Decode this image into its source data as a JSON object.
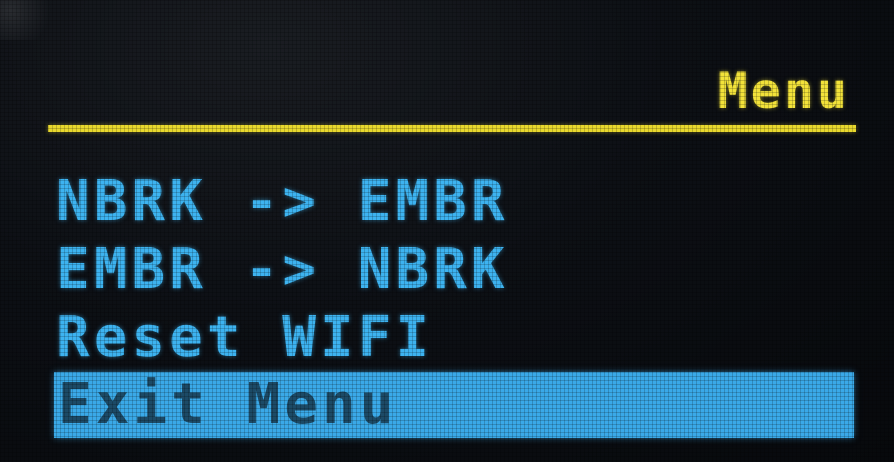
{
  "header": {
    "title": "Menu"
  },
  "menu": {
    "items": [
      {
        "label": "NBRK -> EMBR"
      },
      {
        "label": "EMBR -> NBRK"
      },
      {
        "label": "Reset WIFI"
      },
      {
        "label": "Exit Menu",
        "selected": true
      }
    ]
  },
  "colors": {
    "title": "#f2e23a",
    "rule": "#e8d82e",
    "item_text": "#3db3f0",
    "selected_bg": "#3aa9e8",
    "selected_text": "#1c4a66",
    "background": "#0c0f13"
  }
}
